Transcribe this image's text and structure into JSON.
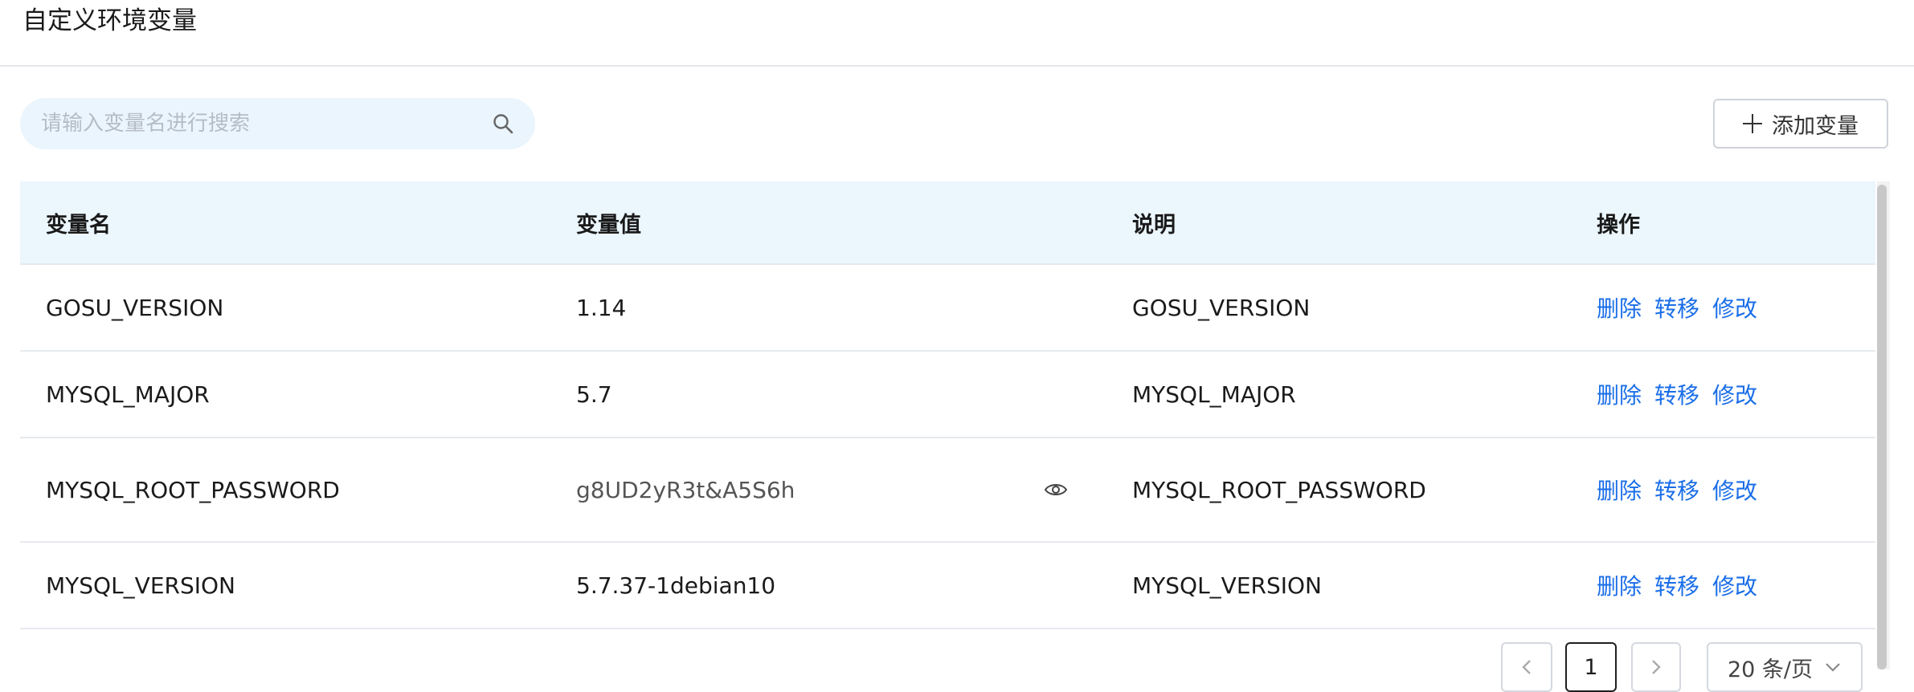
{
  "page": {
    "title": "自定义环境变量"
  },
  "search": {
    "placeholder": "请输入变量名进行搜索"
  },
  "toolbar": {
    "add_label": "添加变量"
  },
  "table": {
    "columns": [
      "变量名",
      "变量值",
      "说明",
      "操作"
    ],
    "rows": [
      {
        "name": "GOSU_VERSION",
        "value": "1.14",
        "description": "GOSU_VERSION",
        "masked": false
      },
      {
        "name": "MYSQL_MAJOR",
        "value": "5.7",
        "description": "MYSQL_MAJOR",
        "masked": false
      },
      {
        "name": "MYSQL_ROOT_PASSWORD",
        "value": "g8UD2yR3t&A5S6h",
        "description": "MYSQL_ROOT_PASSWORD",
        "masked": true
      },
      {
        "name": "MYSQL_VERSION",
        "value": "5.7.37-1debian10",
        "description": "MYSQL_VERSION",
        "masked": false
      }
    ],
    "actions": {
      "delete": "删除",
      "transfer": "转移",
      "edit": "修改"
    }
  },
  "pagination": {
    "current_page": "1",
    "page_size": "20 条/页"
  },
  "colors": {
    "accent": "#1a6ee8",
    "header_bg": "#ebf6fd",
    "search_bg": "#eaf5fd"
  }
}
